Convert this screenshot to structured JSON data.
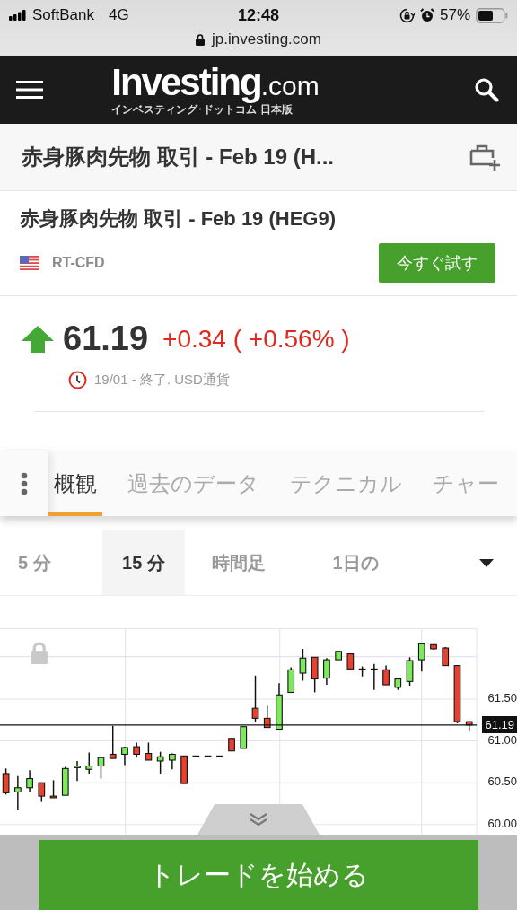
{
  "status_bar": {
    "carrier": "SoftBank",
    "network": "4G",
    "time": "12:48",
    "battery": "57%"
  },
  "browser": {
    "url": "jp.investing.com"
  },
  "header": {
    "logo": {
      "main": "Investing",
      "suffix": ".com",
      "subtitle": "インベスティング･ドットコム 日本版"
    }
  },
  "title_bar": {
    "title": "赤身豚肉先物 取引 - Feb 19 (H..."
  },
  "instrument": {
    "name": "赤身豚肉先物 取引 - Feb 19 (HEG9)",
    "source": "RT-CFD",
    "button": "今すぐ試す"
  },
  "quote": {
    "rising": true,
    "price": "61.19",
    "change": "+0.34 ( +0.56% )",
    "status": "19/01 - 終了. USD通貨"
  },
  "tabs": [
    {
      "label": "概観",
      "selected": true
    },
    {
      "label": "過去のデータ",
      "selected": false
    },
    {
      "label": "テクニカル",
      "selected": false
    },
    {
      "label": "チャー",
      "selected": false
    }
  ],
  "timeframes": [
    {
      "label": "5 分",
      "selected": false
    },
    {
      "label": "15 分",
      "selected": true
    },
    {
      "label": "時間足",
      "selected": false
    },
    {
      "label": "1日の",
      "selected": false
    }
  ],
  "chart": {
    "chart_data": {
      "type": "candlestick",
      "ohlc": [
        [
          60.61,
          60.67,
          60.36,
          60.38
        ],
        [
          60.39,
          60.58,
          60.17,
          60.44
        ],
        [
          60.44,
          60.65,
          60.39,
          60.55
        ],
        [
          60.5,
          60.5,
          60.27,
          60.34
        ],
        [
          60.34,
          60.53,
          60.32,
          60.32
        ],
        [
          60.35,
          60.69,
          60.35,
          60.67
        ],
        [
          60.68,
          60.76,
          60.52,
          60.7
        ],
        [
          60.66,
          60.86,
          60.61,
          60.7
        ],
        [
          60.7,
          60.8,
          60.55,
          60.8
        ],
        [
          60.84,
          61.18,
          60.79,
          60.79
        ],
        [
          60.84,
          60.93,
          60.71,
          60.92
        ],
        [
          60.93,
          60.98,
          60.8,
          60.84
        ],
        [
          60.85,
          60.98,
          60.77,
          60.77
        ],
        [
          60.76,
          60.87,
          60.61,
          60.81
        ],
        [
          60.77,
          60.85,
          60.66,
          60.84
        ],
        [
          60.82,
          60.82,
          60.49,
          60.49
        ],
        [
          60.82,
          60.82,
          60.82,
          60.82
        ],
        [
          60.82,
          60.82,
          60.82,
          60.82
        ],
        [
          60.82,
          60.82,
          60.82,
          60.82
        ],
        [
          61.03,
          61.03,
          60.88,
          60.88
        ],
        [
          60.91,
          61.17,
          60.91,
          61.17
        ],
        [
          61.39,
          61.78,
          61.22,
          61.27
        ],
        [
          61.27,
          61.42,
          61.16,
          61.16
        ],
        [
          61.14,
          61.69,
          61.14,
          61.55
        ],
        [
          61.58,
          61.88,
          61.58,
          61.85
        ],
        [
          61.81,
          62.1,
          61.72,
          61.99
        ],
        [
          62.0,
          62.0,
          61.58,
          61.74
        ],
        [
          61.75,
          61.99,
          61.67,
          61.97
        ],
        [
          61.97,
          62.07,
          61.97,
          62.07
        ],
        [
          62.04,
          62.04,
          61.86,
          61.86
        ],
        [
          61.86,
          61.89,
          61.77,
          61.86
        ],
        [
          61.86,
          61.92,
          61.61,
          61.86
        ],
        [
          61.85,
          61.9,
          61.67,
          61.67
        ],
        [
          61.64,
          61.74,
          61.61,
          61.74
        ],
        [
          61.71,
          62.0,
          61.66,
          61.96
        ],
        [
          61.97,
          62.17,
          61.83,
          62.16
        ],
        [
          62.15,
          62.15,
          62.09,
          62.1
        ],
        [
          62.11,
          62.12,
          61.9,
          61.9
        ],
        [
          61.9,
          61.9,
          61.21,
          61.23
        ],
        [
          61.23,
          61.23,
          61.11,
          61.19
        ]
      ],
      "grid": true,
      "ylim": [
        59.88,
        62.34
      ],
      "yticks": [
        {
          "value": 61.5,
          "label": "61.50"
        },
        {
          "value": 61,
          "label": "61.00"
        },
        {
          "value": 60.5,
          "label": "60.50"
        },
        {
          "value": 60,
          "label": "60.00"
        }
      ],
      "ref_lines": [
        {
          "axis": "y",
          "value": 61.19,
          "label": "61.19"
        }
      ]
    }
  },
  "cta": {
    "label": "トレードを始める"
  }
}
